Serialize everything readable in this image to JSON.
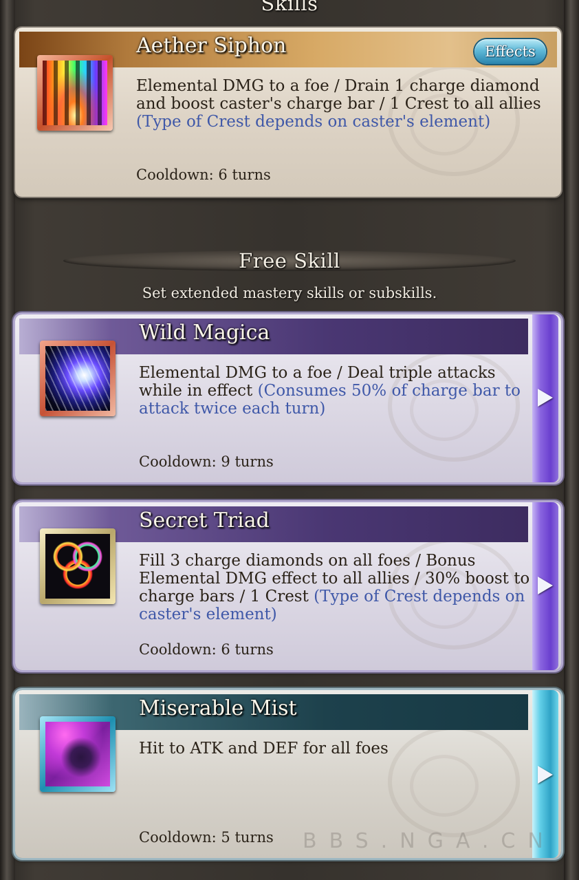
{
  "skills_section": {
    "title": "Skills"
  },
  "aether_siphon": {
    "name": "Aether Siphon",
    "effects_label": "Effects",
    "desc": "Elemental DMG to a foe / Drain 1 charge diamond and boost caster's charge bar / 1 Crest to all allies",
    "hint": "(Type of Crest depends on caster's element)",
    "cooldown": "Cooldown: 6 turns"
  },
  "free_skill_section": {
    "title": "Free Skill",
    "subtitle": "Set extended mastery skills or subskills."
  },
  "free_skills": [
    {
      "name": "Wild Magica",
      "desc": "Elemental DMG to a foe / Deal triple attacks while in effect",
      "hint": "(Consumes 50% of charge bar to attack twice each turn)",
      "cooldown": "Cooldown: 9 turns"
    },
    {
      "name": "Secret Triad",
      "desc": "Fill 3 charge diamonds on all foes / Bonus Elemental DMG effect to all allies / 30% boost to charge bars / 1 Crest",
      "hint": "(Type of Crest depends on caster's element)",
      "cooldown": "Cooldown: 6 turns"
    },
    {
      "name": "Miserable Mist",
      "desc": "Hit to ATK and DEF for all foes",
      "hint": "",
      "cooldown": "Cooldown: 5 turns"
    }
  ],
  "watermark": "BBS.NGA.CN",
  "colors": {
    "hint_text": "#3f58a8",
    "effects_button": "#5fb9d8",
    "purple_tab": "#6a3fcf",
    "teal_tab": "#2fa3c6"
  },
  "icons": {
    "aether_siphon": "rainbow-pillar-icon",
    "wild_magica": "shard-burst-icon",
    "secret_triad": "triple-ring-icon",
    "miserable_mist": "mist-figure-icon",
    "tab_arrow": "play-arrow-icon"
  }
}
